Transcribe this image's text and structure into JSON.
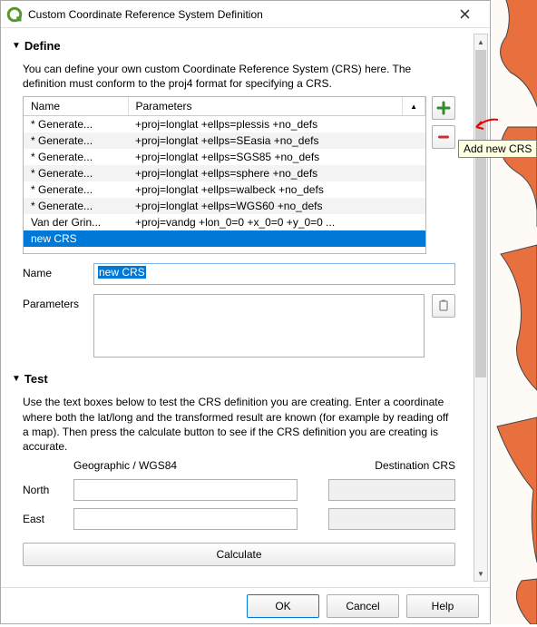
{
  "window": {
    "title": "Custom Coordinate Reference System Definition"
  },
  "define": {
    "heading": "Define",
    "description": "You can define your own custom Coordinate Reference System (CRS) here. The definition must conform to the proj4 format for specifying a CRS.",
    "columns": {
      "name": "Name",
      "params": "Parameters"
    },
    "rows": [
      {
        "name": "* Generate...",
        "params": "+proj=longlat +ellps=plessis +no_defs"
      },
      {
        "name": "* Generate...",
        "params": "+proj=longlat +ellps=SEasia +no_defs"
      },
      {
        "name": "* Generate...",
        "params": "+proj=longlat +ellps=SGS85 +no_defs"
      },
      {
        "name": "* Generate...",
        "params": "+proj=longlat +ellps=sphere +no_defs"
      },
      {
        "name": "* Generate...",
        "params": "+proj=longlat +ellps=walbeck +no_defs"
      },
      {
        "name": "* Generate...",
        "params": "+proj=longlat +ellps=WGS60 +no_defs"
      },
      {
        "name": "Van der Grin...",
        "params": "+proj=vandg +lon_0=0 +x_0=0 +y_0=0 ..."
      },
      {
        "name": "new CRS",
        "params": ""
      }
    ],
    "selected_row_index": 7,
    "name_label": "Name",
    "name_value": "new CRS",
    "params_label": "Parameters",
    "params_value": "",
    "add_tooltip": "Add new CRS"
  },
  "test": {
    "heading": "Test",
    "description": "Use the text boxes below to test the CRS definition you are creating. Enter a coordinate where both the lat/long and the transformed result are known (for example by reading off a map). Then press the calculate button to see if the CRS definition you are creating is accurate.",
    "col_geo": "Geographic / WGS84",
    "col_dest": "Destination CRS",
    "north_label": "North",
    "east_label": "East",
    "north_value": "",
    "east_value": "",
    "north_dest": "",
    "east_dest": "",
    "calculate": "Calculate"
  },
  "footer": {
    "ok": "OK",
    "cancel": "Cancel",
    "help": "Help"
  }
}
